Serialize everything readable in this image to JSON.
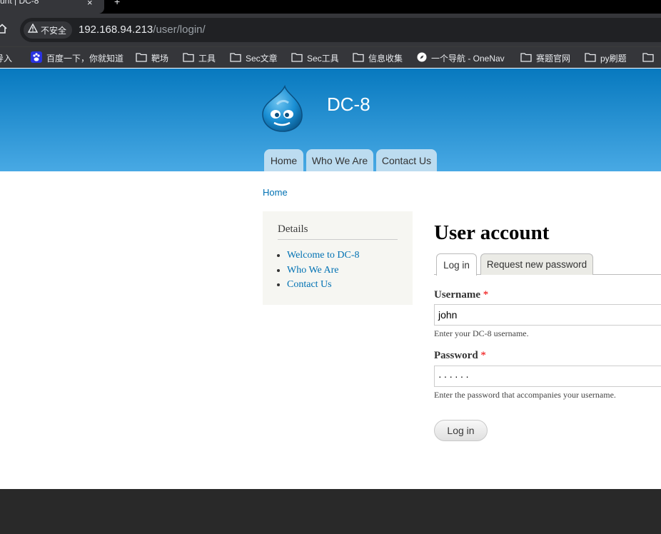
{
  "browser": {
    "tab_title": "unt | DC-8",
    "tab_close": "×",
    "new_tab": "+",
    "security_label": "不安全",
    "url_host": "192.168.94.213",
    "url_path": "/user/login/",
    "bookmarks": [
      {
        "label": "导入",
        "icon": "import-icon"
      },
      {
        "label": "百度一下，你就知道",
        "icon": "baidu-icon"
      },
      {
        "label": "靶场",
        "icon": "folder-icon"
      },
      {
        "label": "工具",
        "icon": "folder-icon"
      },
      {
        "label": "Sec文章",
        "icon": "folder-icon"
      },
      {
        "label": "Sec工具",
        "icon": "folder-icon"
      },
      {
        "label": "信息收集",
        "icon": "folder-icon"
      },
      {
        "label": "一个导航 - OneNav",
        "icon": "onenav-icon"
      },
      {
        "label": "赛题官网",
        "icon": "folder-icon"
      },
      {
        "label": "py刷题",
        "icon": "folder-icon"
      }
    ]
  },
  "site": {
    "name": "DC-8",
    "nav": [
      "Home",
      "Who We Are",
      "Contact Us"
    ],
    "header_color": "#0779bf"
  },
  "breadcrumb": "Home",
  "sidebar": {
    "title": "Details",
    "links": [
      "Welcome to DC-8",
      "Who We Are",
      "Contact Us"
    ]
  },
  "main": {
    "title": "User account",
    "tabs": [
      "Log in",
      "Request new password"
    ],
    "username": {
      "label": "Username",
      "required": "*",
      "value": "john",
      "description": "Enter your DC-8 username."
    },
    "password": {
      "label": "Password",
      "required": "*",
      "value": "······",
      "description": "Enter the password that accompanies your username."
    },
    "submit": "Log in"
  },
  "colors": {
    "link": "#0071b3",
    "footer": "#292929"
  }
}
